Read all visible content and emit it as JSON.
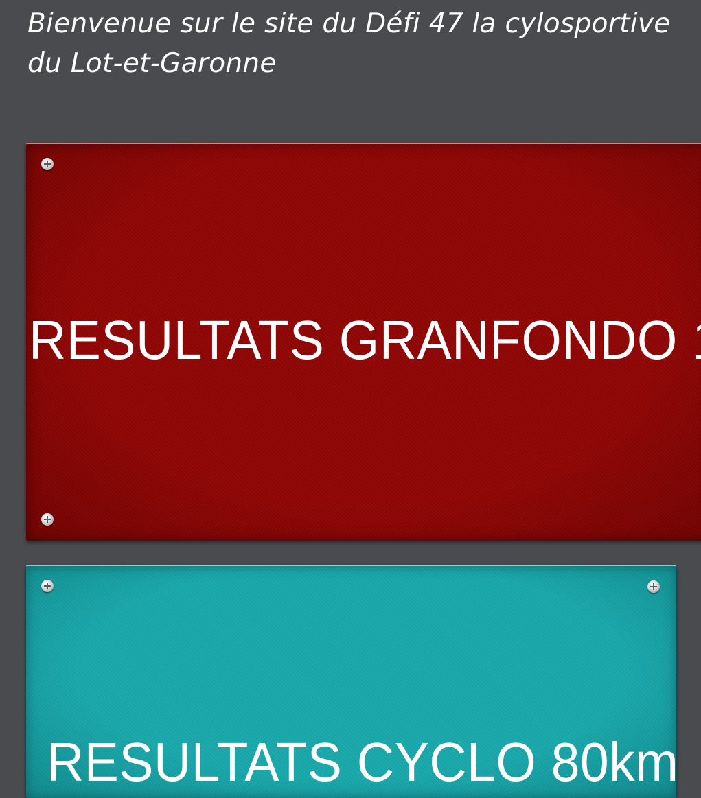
{
  "welcome": {
    "text": "Bienvenue sur le site du Défi 47 la cylosportive du Lot-et-Garonne"
  },
  "panels": [
    {
      "label": "RESULTATS GRANFONDO 1",
      "color": "#8e0605"
    },
    {
      "label": "RESULTATS CYCLO 80km",
      "color": "#19a7aa"
    }
  ],
  "icons": {
    "screw": "screw-icon"
  },
  "colors": {
    "background": "#4a4b4f",
    "text": "#ffffff"
  }
}
